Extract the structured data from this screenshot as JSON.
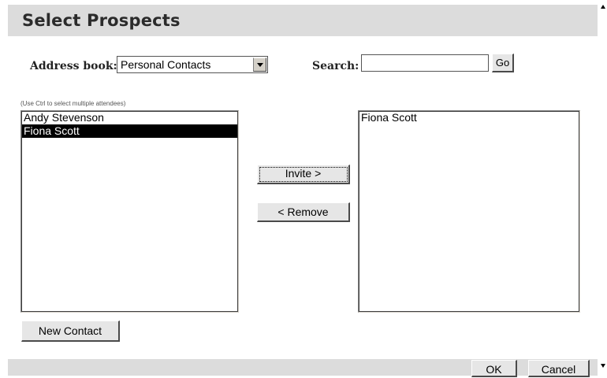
{
  "dialog": {
    "title": "Select Prospects"
  },
  "address_book": {
    "label": "Address book:",
    "selected": "Personal Contacts"
  },
  "search": {
    "label": "Search:",
    "value": "",
    "go_label": "Go"
  },
  "hint": "(Use Ctrl to select multiple attendees)",
  "available": {
    "items": [
      {
        "label": "Andy Stevenson",
        "selected": false
      },
      {
        "label": "Fiona Scott",
        "selected": true
      }
    ]
  },
  "buttons": {
    "invite": "Invite >",
    "remove": "< Remove",
    "new_contact": "New Contact",
    "ok": "OK",
    "cancel": "Cancel"
  },
  "invited": {
    "items": [
      {
        "label": "Fiona Scott"
      }
    ]
  }
}
